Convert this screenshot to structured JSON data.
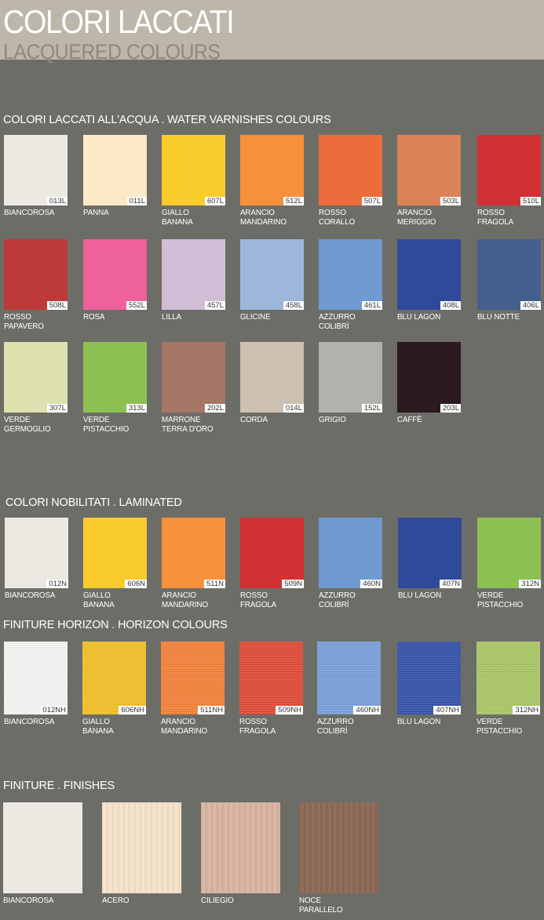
{
  "header": {
    "title": "COLORI LACCATI",
    "subtitle": "LACQUERED COLOURS",
    "color": "#bdb6aa"
  },
  "sections": {
    "water": {
      "title": "COLORI LACCATI ALL'ACQUA  .  WATER VARNISHES COLOURS",
      "swatches": [
        {
          "name": "BIANCOROSA",
          "code": "013L",
          "color": "#ece9e3"
        },
        {
          "name": "PANNA",
          "code": "011L",
          "color": "#fce9c6"
        },
        {
          "name": "GIALLO\nBANANA",
          "code": "607L",
          "color": "#f9cb2b"
        },
        {
          "name": "ARANCIO\nMANDARINO",
          "code": "512L",
          "color": "#f7903b"
        },
        {
          "name": "ROSSO\nCORALLO",
          "code": "507L",
          "color": "#ec6c3c"
        },
        {
          "name": "ARANCIO\nMERIGGIO",
          "code": "503L",
          "color": "#db8256"
        },
        {
          "name": "ROSSO\nFRAGOLA",
          "code": "510L",
          "color": "#d23033"
        },
        {
          "name": "ROSSO\nPAPAVERO",
          "code": "508L",
          "color": "#bd3a38"
        },
        {
          "name": "ROSA",
          "code": "552L",
          "color": "#ee619a"
        },
        {
          "name": "LILLA",
          "code": "457L",
          "color": "#d2bdd6"
        },
        {
          "name": "GLICINE",
          "code": "458L",
          "color": "#9db6dc"
        },
        {
          "name": "AZZURRO\nCOLIBRÌ",
          "code": "461L",
          "color": "#6f9ad2"
        },
        {
          "name": "BLU LAGON",
          "code": "408L",
          "color": "#2f4a9a"
        },
        {
          "name": "BLU NOTTE",
          "code": "406L",
          "color": "#455f8d"
        },
        {
          "name": "VERDE\nGERMOGLIO",
          "code": "307L",
          "color": "#dde0af"
        },
        {
          "name": "VERDE\nPISTACCHIO",
          "code": "313L",
          "color": "#8cc152"
        },
        {
          "name": "MARRONE\nTERRA D'ORO",
          "code": "202L",
          "color": "#a67666"
        },
        {
          "name": "CORDA",
          "code": "014L",
          "color": "#cbc0b1"
        },
        {
          "name": "GRIGIO",
          "code": "152L",
          "color": "#b3b1ac"
        },
        {
          "name": "CAFFÈ",
          "code": "203L",
          "color": "#2b1a1f"
        }
      ]
    },
    "laminated": {
      "title": "COLORI NOBILITATI  .  LAMINATED",
      "swatches": [
        {
          "name": "BIANCOROSA",
          "code": "012N",
          "color": "#ece9e3"
        },
        {
          "name": "GIALLO\nBANANA",
          "code": "606N",
          "color": "#f9cb2b"
        },
        {
          "name": "ARANCIO\nMANDARINO",
          "code": "511N",
          "color": "#f7903b"
        },
        {
          "name": "ROSSO\nFRAGOLA",
          "code": "509N",
          "color": "#d23033"
        },
        {
          "name": "AZZURRO\nCOLIBRÌ",
          "code": "460N",
          "color": "#6f9ad2"
        },
        {
          "name": "BLU LAGON",
          "code": "407N",
          "color": "#2f4a9a"
        },
        {
          "name": "VERDE\nPISTACCHIO",
          "code": "312N",
          "color": "#8cc152"
        }
      ]
    },
    "horizon": {
      "title": "FINITURE HORIZON  .  HORIZON COLOURS",
      "swatches": [
        {
          "name": "BIANCOROSA",
          "code": "012NH",
          "color": "#f4f4f2"
        },
        {
          "name": "GIALLO\nBANANA",
          "code": "606NH",
          "color": "#f1c128"
        },
        {
          "name": "ARANCIO\nMANDARINO",
          "code": "511NH",
          "color": "#f3823a"
        },
        {
          "name": "ROSSO\nFRAGOLA",
          "code": "509NH",
          "color": "#e04b38"
        },
        {
          "name": "AZZURRO\nCOLIBRÌ",
          "code": "460NH",
          "color": "#79a0d8"
        },
        {
          "name": "BLU LAGON",
          "code": "407NH",
          "color": "#3553a8"
        },
        {
          "name": "VERDE\nPISTACCHIO",
          "code": "312NH",
          "color": "#aac766"
        }
      ]
    },
    "finishes": {
      "title": "FINITURE  .  FINISHES",
      "swatches": [
        {
          "name": "BIANCOROSA",
          "color": "#ece9e3",
          "texture": "plain"
        },
        {
          "name": "ACERO",
          "color": "#f6e3cc",
          "texture": "wood"
        },
        {
          "name": "CILIEGIO",
          "color": "#dab5a2",
          "texture": "wood"
        },
        {
          "name": "NOCE\nPARALLELO",
          "color": "#8c6a55",
          "texture": "wood"
        }
      ]
    }
  }
}
